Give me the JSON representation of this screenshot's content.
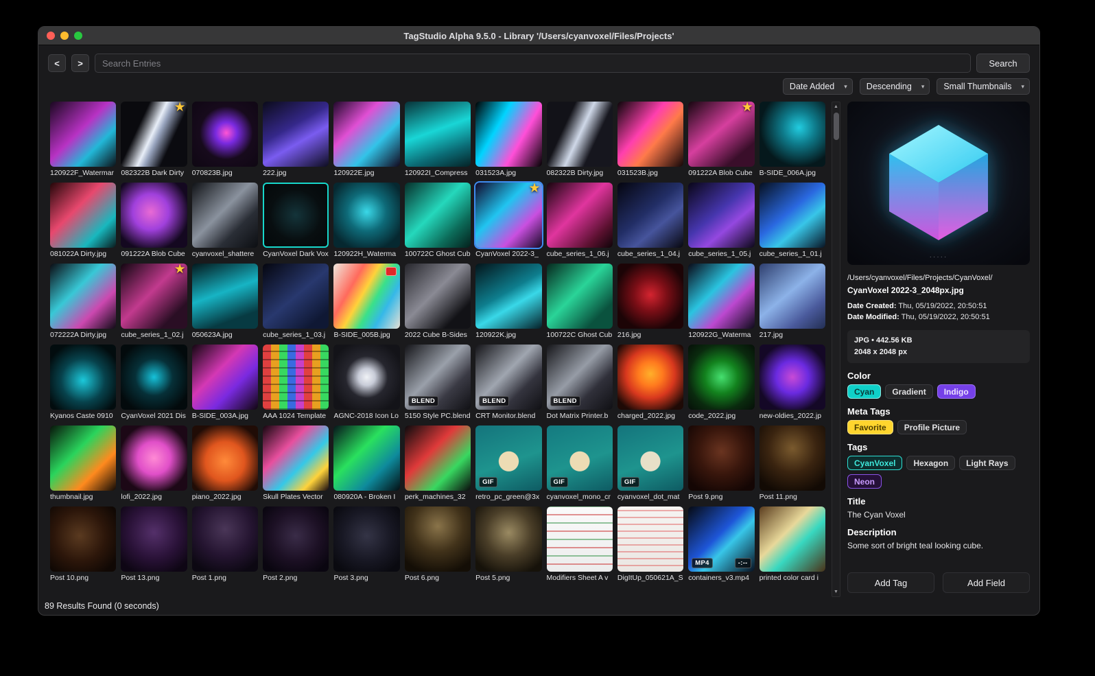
{
  "window": {
    "title": "TagStudio Alpha 9.5.0 - Library '/Users/cyanvoxel/Files/Projects'"
  },
  "toolbar": {
    "back": "<",
    "forward": ">",
    "search_placeholder": "Search Entries",
    "search_button": "Search"
  },
  "sortbar": {
    "field": "Date Added",
    "direction": "Descending",
    "size": "Small Thumbnails",
    "arrow": "▾"
  },
  "scrollbar": {
    "up": "▲",
    "down": "▼"
  },
  "grid": {
    "selection_color": "#3f8cf0",
    "items": [
      {
        "n": "120922F_Watermar",
        "bg": "linear-gradient(135deg,#1a0820,#b832c4 45%,#22b8d8 70%,#0c1016)"
      },
      {
        "n": "082322B Dark Dirty",
        "star": true,
        "bg": "linear-gradient(115deg,#0a0a0e 30%,#e8eef8 48%,#9aa6c0 55%,#0b0b10 72%)"
      },
      {
        "n": "070823B.jpg",
        "bg": "radial-gradient(circle at 52% 48%,#ff55d4 0%,#7a2ae0 22%,#170a1c 55%,#0e0712 100%)"
      },
      {
        "n": "222.jpg",
        "bg": "linear-gradient(150deg,#0b0b1a,#35288a 40%,#7a5cf0 60%,#0d0d20)"
      },
      {
        "n": "120922E.jpg",
        "bg": "linear-gradient(135deg,#20082a,#e04fd4 35%,#32c4e8 65%,#12081e)"
      },
      {
        "n": "120922I_Compress",
        "bg": "linear-gradient(160deg,#083238,#19d6d6 45%,#0b6a74 75%,#052226)"
      },
      {
        "n": "031523A.jpg",
        "bg": "linear-gradient(120deg,#000000,#00d4ff 35%,#ff4fd8 65%,#000000)"
      },
      {
        "n": "082322B Dirty.jpg",
        "bg": "linear-gradient(115deg,#121218 30%,#cfd8e8 50%,#16161e 70%)"
      },
      {
        "n": "031523B.jpg",
        "bg": "linear-gradient(130deg,#0a0508,#ff3fae 40%,#ff7a4a 60%,#120608)"
      },
      {
        "n": "091222A Blob Cube",
        "star": true,
        "bg": "linear-gradient(140deg,#16060f,#d63f9e 45%,#3a0e2a 80%)"
      },
      {
        "n": "B-SIDE_006A.jpg",
        "bg": "radial-gradient(circle at 60% 40%,#22cce0 0%,#0e7a8a 30%,#05181c 70%)"
      },
      {
        "n": "081022A Dirty.jpg",
        "bg": "linear-gradient(135deg,#230608,#e8486e 40%,#18b8be 75%,#0a1a1c)"
      },
      {
        "n": "091222A Blob Cube",
        "bg": "radial-gradient(circle at 45% 45%,#e86ad4 0%,#a040dc 35%,#140820 75%)"
      },
      {
        "n": "cyanvoxel_shattere",
        "bg": "linear-gradient(135deg,#101216,#8a929e 45%,#2a2e36 70%,#0c0e12)"
      },
      {
        "n": "CyanVoxel Dark Vox",
        "bd": "#17d8cc",
        "bg": "radial-gradient(circle at 50% 50%,#14343a 0%,#080e10 55%,#04080a 100%)"
      },
      {
        "n": "120922H_Waterma",
        "bg": "radial-gradient(circle at 50% 45%,#3ad8e8 0%,#0e6a78 40%,#062830 80%)"
      },
      {
        "n": "100722C Ghost Cub",
        "bg": "linear-gradient(135deg,#062e2a,#25d8bc 45%,#0c6a58 75%,#04201c)"
      },
      {
        "n": "CyanVoxel 2022-3_",
        "star": true,
        "sel": true,
        "bg": "linear-gradient(135deg,#12082a,#20c4f0 40%,#c94fe0 70%,#160a24)"
      },
      {
        "n": "cube_series_1_06.j",
        "bg": "linear-gradient(135deg,#16040c,#e0359e 45%,#58102e 80%,#0e0408)"
      },
      {
        "n": "cube_series_1_04.j",
        "bg": "linear-gradient(140deg,#05050f,#222e66 45%,#46549c 65%,#07070f)"
      },
      {
        "n": "cube_series_1_05.j",
        "bg": "linear-gradient(140deg,#0a0618,#4636ae 45%,#9448e0 65%,#0c0818)"
      },
      {
        "n": "cube_series_1_01.j",
        "bg": "linear-gradient(140deg,#061020,#2a68e0 45%,#38c6e8 65%,#081424)"
      },
      {
        "n": "072222A Dirty.jpg",
        "bg": "linear-gradient(135deg,#0b0b12,#38c8d6 40%,#cc48b0 70%,#0e0a14)"
      },
      {
        "n": "cube_series_1_02.j",
        "star": true,
        "bg": "linear-gradient(135deg,#110610,#c23a8e 45%,#2a0e24 80%)"
      },
      {
        "n": "050623A.jpg",
        "bg": "linear-gradient(160deg,#04181c,#17b4c4 45%,#073a42 80%)"
      },
      {
        "n": "cube_series_1_03.j",
        "bg": "linear-gradient(140deg,#05060f,#28386e 50%,#0f1834 85%)"
      },
      {
        "n": "B-SIDE_005B.jpg",
        "chip": true,
        "bg": "linear-gradient(120deg,#efe8de,#ff6a5c 30%,#ffd23a 45%,#3ae08a 60%,#35b8e8 75%,#e8e0d4)"
      },
      {
        "n": "2022 Cube B-Sides",
        "bg": "linear-gradient(135deg,#26262c,#8a8a94 45%,#121216 80%)"
      },
      {
        "n": "120922K.jpg",
        "bg": "linear-gradient(150deg,#04141a,#0e7e8e 45%,#39d8e8 62%,#052028)"
      },
      {
        "n": "100722C Ghost Cub",
        "bg": "linear-gradient(135deg,#06281e,#2ad498 45%,#0a523e 80%)"
      },
      {
        "n": "216.jpg",
        "bg": "radial-gradient(circle at 50% 48%,#d42430 0%,#7a0e16 35%,#1c0406 75%)"
      },
      {
        "n": "120922G_Waterma",
        "bg": "linear-gradient(135deg,#0a0a18,#2ac4e0 40%,#bc48d0 65%,#0c0a18)"
      },
      {
        "n": "217.jpg",
        "bg": "linear-gradient(140deg,#2e3e6e,#8cb2e8 45%,#4a5a9c 75%,#222e52)"
      },
      {
        "n": "Kyanos Caste 0910",
        "bg": "radial-gradient(circle at 50% 55%,#1cc8da 0%,#07424c 45%,#020c0e 80%)"
      },
      {
        "n": "CyanVoxel 2021 Dis",
        "bg": "radial-gradient(circle at 50% 50%,#16c2da 0%,#063038 40%,#030a0c 80%)"
      },
      {
        "n": "B-SIDE_003A.jpg",
        "bg": "linear-gradient(135deg,#130610,#d438b4 40%,#7a2ae0 65%,#10060e)"
      },
      {
        "n": "AAA 1024 Template",
        "bg": "repeating-linear-gradient(0deg,rgba(0,0,0,.35) 0 2px,transparent 2px 12px),repeating-linear-gradient(90deg,#e04040 0 12px,#e8a020 12px 24px,#38d860 24px 36px,#3a6ae0 36px 48px,#c840c8 48px 60px)"
      },
      {
        "n": "AGNC-2018 Icon Lo",
        "bg": "radial-gradient(circle at 50% 50%,#f0f2f6 0%,#c8ccd8 18%,#26262e 45%,#131318 80%)"
      },
      {
        "n": "5150 Style PC.blend",
        "badge": "BLEND",
        "bg": "linear-gradient(135deg,#141418,#9aa0aa 45%,#3a3a44 70%,#101014)"
      },
      {
        "n": "CRT Monitor.blend",
        "badge": "BLEND",
        "bg": "linear-gradient(135deg,#141418,#a0a6b0 45%,#34343e 70%,#101014)"
      },
      {
        "n": "Dot Matrix Printer.b",
        "badge": "BLEND",
        "bg": "linear-gradient(135deg,#16161a,#969ca6 45%,#30303a 70%,#101014)"
      },
      {
        "n": "charged_2022.jpg",
        "bg": "radial-gradient(circle at 50% 45%,#ffb02a 0%,#ff7a1e 25%,#d8381e 50%,#1e0a06 85%)"
      },
      {
        "n": "code_2022.jpg",
        "bg": "radial-gradient(circle at 50% 50%,#46e070 0%,#13821e 35%,#0a2a0e 70%,#060f08 100%)"
      },
      {
        "n": "new-oldies_2022.jp",
        "bg": "radial-gradient(circle at 50% 50%,#c84ad6 0%,#6a2ae0 35%,#140826 75%)"
      },
      {
        "n": "thumbnail.jpg",
        "bg": "linear-gradient(135deg,#08140a,#2ad45c 40%,#ff8a1e 70%,#100a06)"
      },
      {
        "n": "lofi_2022.jpg",
        "bg": "radial-gradient(circle at 50% 50%,#ff8ad4 0%,#e04fc8 35%,#1c0816 75%)"
      },
      {
        "n": "piano_2022.jpg",
        "bg": "radial-gradient(circle at 50% 55%,#ff8a3a 0%,#e0561e 40%,#200c06 80%)"
      },
      {
        "n": "Skull Plates Vector",
        "bg": "linear-gradient(135deg,#14060e,#e84f9e 35%,#35c8e8 60%,#ffd23a 80%,#140810)"
      },
      {
        "n": "080920A - Broken I",
        "bg": "linear-gradient(135deg,#06141a,#2ae05e 40%,#0e8a9c 70%,#041014)"
      },
      {
        "n": "perk_machines_32",
        "bg": "linear-gradient(135deg,#0b0b0d,#e03a3a 40%,#38d860 70%,#0a0a0c)"
      },
      {
        "n": "retro_pc_green@3x",
        "badge": "GIF",
        "bg": "radial-gradient(circle at 50% 55%,#ecdcb4 0 20%,transparent 21%),linear-gradient(160deg,#14747c,#1e948e 55%,#0e5a62)"
      },
      {
        "n": "cyanvoxel_mono_cr",
        "badge": "GIF",
        "bg": "radial-gradient(circle at 50% 55%,#ecdcb4 0 20%,transparent 21%),linear-gradient(160deg,#147a80,#1e948e 55%,#0e5a62)"
      },
      {
        "n": "cyanvoxel_dot_mat",
        "badge": "GIF",
        "bg": "radial-gradient(circle at 50% 55%,#e8e0c8 0 20%,transparent 21%),linear-gradient(160deg,#14747c,#1e948e 55%,#0e5a62)"
      },
      {
        "n": "Post 9.png",
        "bg": "radial-gradient(circle at 50% 40%,#6a3420 0%,#38160c 45%,#140604 85%)"
      },
      {
        "n": "Post 11.png",
        "bg": "radial-gradient(circle at 50% 35%,#7a5a2e 0%,#3a2410 45%,#120a04 85%)"
      },
      {
        "n": "Post 10.png",
        "bg": "radial-gradient(circle at 45% 45%,#5a3a20 0%,#2c160a 50%,#100804 85%)"
      },
      {
        "n": "Post 13.png",
        "bg": "radial-gradient(circle at 50% 40%,#54306a 0%,#2a1238 50%,#0e0614 85%)"
      },
      {
        "n": "Post 1.png",
        "bg": "radial-gradient(circle at 50% 35%,#4a3658 0%,#241430 50%,#0c0812 85%)"
      },
      {
        "n": "Post 2.png",
        "bg": "radial-gradient(circle at 50% 45%,#3a2c48 0%,#1c1024 50%,#0a0610 85%)"
      },
      {
        "n": "Post 3.png",
        "bg": "radial-gradient(circle at 50% 45%,#343446 0%,#181824 50%,#0a0a10 85%)"
      },
      {
        "n": "Post 6.png",
        "bg": "radial-gradient(circle at 50% 30%,#8a744a 0%,#41321a 45%,#140e06 85%)"
      },
      {
        "n": "Post 5.png",
        "bg": "radial-gradient(circle at 50% 40%,#9a8a62 0%,#4a3e28 45%,#16120a 85%)"
      },
      {
        "n": "Modifiers Sheet A v",
        "bg": "repeating-linear-gradient(0deg,transparent 0 10px,rgba(200,40,40,.5) 10px 12px,transparent 12px 22px,rgba(40,140,60,.5) 22px 24px),linear-gradient(180deg,#fafafa,#ececec)"
      },
      {
        "n": "DigItUp_050621A_S",
        "bg": "repeating-linear-gradient(0deg,transparent 0 8px,rgba(220,60,60,.4) 8px 10px),linear-gradient(180deg,#f6f4f2,#eae6e2)"
      },
      {
        "n": "containers_v3.mp4",
        "badge": "MP4",
        "badge2": "-:--",
        "bg": "linear-gradient(135deg,#060a12,#1e56d8 45%,#38c6e8 60%,#081020)"
      },
      {
        "n": "printed color card i",
        "bg": "linear-gradient(135deg,#5a3c1e,#e8d89a 40%,#38d8c0 60%,#4a3218)"
      }
    ]
  },
  "panel": {
    "path": "/Users/cyanvoxel/Files/Projects/CyanVoxel/",
    "filename": "CyanVoxel 2022-3_2048px.jpg",
    "created_label": "Date Created:",
    "created": "Thu, 05/19/2022, 20:50:51",
    "modified_label": "Date Modified:",
    "modified": "Thu, 05/19/2022, 20:50:51",
    "info_line1": "JPG • 442.56 KB",
    "info_line2": "2048 x 2048 px",
    "sections": [
      {
        "label": "Color",
        "tags": [
          {
            "t": "Cyan",
            "bg": "#0fd0c8",
            "fg": "#0a3a38",
            "bd": "#8ceae4"
          },
          {
            "t": "Gradient",
            "bg": "#252527",
            "fg": "#e2e2e4",
            "bd": "#3a3a3e"
          },
          {
            "t": "Indigo",
            "bg": "#7540e8",
            "fg": "#ece2ff",
            "bd": "#9a70f0"
          }
        ]
      },
      {
        "label": "Meta Tags",
        "tags": [
          {
            "t": "Favorite",
            "bg": "#ffd52e",
            "fg": "#4a3c00",
            "bd": "#ffe27a"
          },
          {
            "t": "Profile Picture",
            "bg": "#252527",
            "fg": "#e2e2e4",
            "bd": "#3a3a3e"
          }
        ]
      },
      {
        "label": "Tags",
        "tags": [
          {
            "t": "CyanVoxel",
            "bg": "#0e2e2e",
            "fg": "#3ee8dc",
            "bd": "#2ee0d4"
          },
          {
            "t": "Hexagon",
            "bg": "#252527",
            "fg": "#e2e2e4",
            "bd": "#3a3a3e"
          },
          {
            "t": "Light Rays",
            "bg": "#252527",
            "fg": "#e2e2e4",
            "bd": "#3a3a3e"
          },
          {
            "t": "Neon",
            "bg": "#251038",
            "fg": "#c89aff",
            "bd": "#8a52e8"
          }
        ]
      }
    ],
    "title_label": "Title",
    "title_value": "The Cyan Voxel",
    "desc_label": "Description",
    "desc_value": "Some sort of bright teal looking cube.",
    "add_tag": "Add Tag",
    "add_field": "Add Field",
    "preview_dots": "·····"
  },
  "statusbar": {
    "text": "89 Results Found (0 seconds)"
  }
}
